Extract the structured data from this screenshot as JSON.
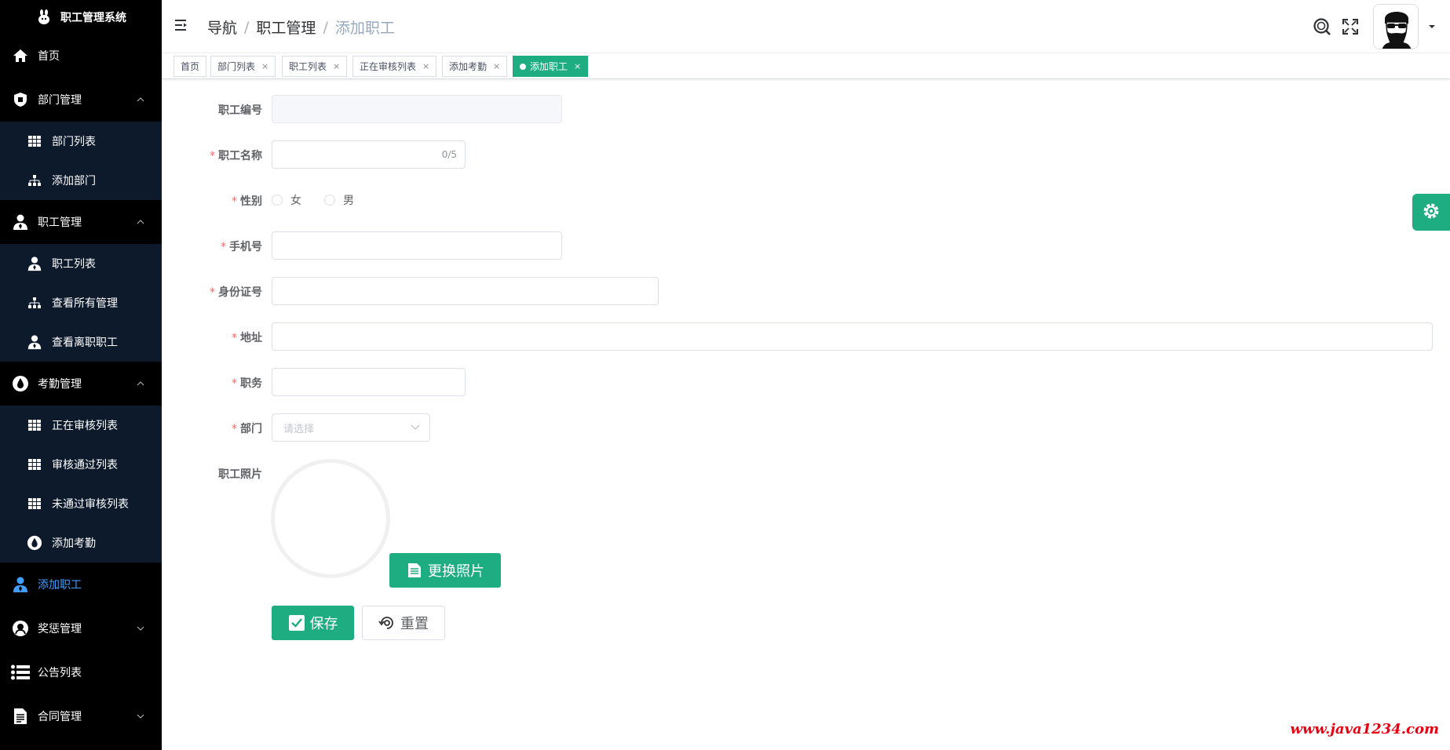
{
  "app": {
    "title": "职工管理系统"
  },
  "sidebar": {
    "items": [
      {
        "key": "home",
        "label": "首页",
        "icon": "home-icon"
      },
      {
        "key": "dept",
        "label": "部门管理",
        "icon": "shield-icon",
        "expanded": true,
        "children": [
          {
            "label": "部门列表",
            "icon": "grid-icon"
          },
          {
            "label": "添加部门",
            "icon": "org-chart-icon"
          }
        ]
      },
      {
        "key": "staff",
        "label": "职工管理",
        "icon": "user-icon",
        "expanded": true,
        "children": [
          {
            "label": "职工列表",
            "icon": "user-icon"
          },
          {
            "label": "查看所有管理",
            "icon": "org-chart-icon"
          },
          {
            "label": "查看离职职工",
            "icon": "user-icon"
          }
        ]
      },
      {
        "key": "attendance",
        "label": "考勤管理",
        "icon": "drop-icon",
        "expanded": true,
        "children": [
          {
            "label": "正在审核列表",
            "icon": "grid-icon"
          },
          {
            "label": "审核通过列表",
            "icon": "grid-icon"
          },
          {
            "label": "未通过审核列表",
            "icon": "grid-icon"
          },
          {
            "label": "添加考勤",
            "icon": "drop-icon"
          }
        ]
      },
      {
        "key": "add-staff",
        "label": "添加职工",
        "icon": "user-icon",
        "active": true
      },
      {
        "key": "reward",
        "label": "奖惩管理",
        "icon": "medal-icon",
        "expanded": false
      },
      {
        "key": "notice",
        "label": "公告列表",
        "icon": "list-icon"
      },
      {
        "key": "contract",
        "label": "合同管理",
        "icon": "document-icon",
        "expanded": false
      }
    ]
  },
  "header": {
    "breadcrumb": [
      "导航",
      "职工管理",
      "添加职工"
    ]
  },
  "tags": [
    {
      "label": "首页",
      "closable": false
    },
    {
      "label": "部门列表",
      "closable": true
    },
    {
      "label": "职工列表",
      "closable": true
    },
    {
      "label": "正在审核列表",
      "closable": true
    },
    {
      "label": "添加考勤",
      "closable": true
    },
    {
      "label": "添加职工",
      "closable": true,
      "active": true
    }
  ],
  "tag_close": "×",
  "form": {
    "id_label": "职工编号",
    "id_value": "",
    "name_label": "职工名称",
    "name_counter": "0/5",
    "gender_label": "性别",
    "gender_options": [
      "女",
      "男"
    ],
    "phone_label": "手机号",
    "idcard_label": "身份证号",
    "address_label": "地址",
    "position_label": "职务",
    "dept_label": "部门",
    "dept_placeholder": "请选择",
    "photo_label": "职工照片",
    "change_photo": "更换照片",
    "save": "保存",
    "reset": "重置",
    "required_mark": "*"
  },
  "watermark": "www.java1234.com",
  "colors": {
    "accent": "#1ead80",
    "sidebar_bg": "#000000",
    "submenu_bg": "#0c1a2c",
    "active_menu": "#409eff",
    "required": "#f56c6c"
  }
}
